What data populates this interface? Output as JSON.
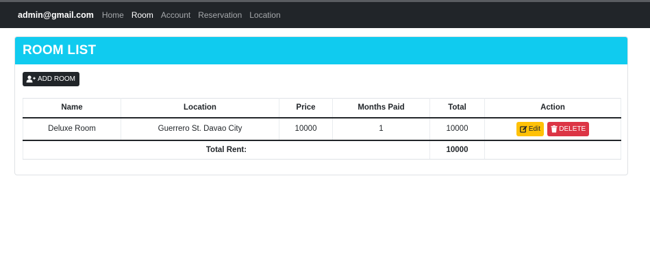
{
  "navbar": {
    "brand": "admin@gmail.com",
    "links": [
      "Home",
      "Room",
      "Account",
      "Reservation",
      "Location"
    ],
    "active": "Room"
  },
  "card": {
    "title": "ROOM LIST",
    "add_button": "ADD ROOM"
  },
  "table": {
    "headers": [
      "Name",
      "Location",
      "Price",
      "Months Paid",
      "Total",
      "Action"
    ],
    "rows": [
      {
        "name": "Deluxe Room",
        "location": "Guerrero St. Davao City",
        "price": "10000",
        "months_paid": "1",
        "total": "10000"
      }
    ],
    "edit_label": "Edit",
    "delete_label": "DELETE",
    "footer_label": "Total Rent:",
    "footer_total": "10000"
  },
  "colors": {
    "navbar": "#212529",
    "header": "#10cbef",
    "edit": "#ffc107",
    "delete": "#dc3545"
  },
  "icons": {
    "add": "user-plus-icon",
    "edit": "edit-icon",
    "delete": "trash-icon"
  }
}
